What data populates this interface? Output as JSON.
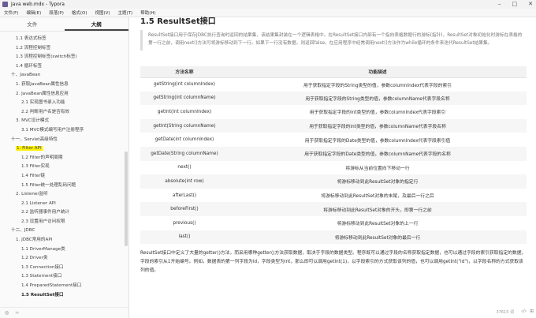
{
  "window": {
    "title": "Java web.mdx - Typora",
    "controls": [
      "–",
      "□",
      "✕"
    ]
  },
  "menu": [
    "文件(F)",
    "编辑(E)",
    "段落(P)",
    "格式(O)",
    "视图(V)",
    "主题(T)",
    "帮助(H)"
  ],
  "sidebar": {
    "tabs": [
      "文件",
      "大纲"
    ],
    "active_tab": 1,
    "outline": [
      {
        "level": 2,
        "label": "1.1 表达式标签"
      },
      {
        "level": 2,
        "label": "1.2 流程控制标签"
      },
      {
        "level": 2,
        "label": "1.3 流程控制标签(switch标签)"
      },
      {
        "level": 2,
        "label": "1.4 循环标签"
      },
      {
        "level": 1,
        "label": "十、JavaBean"
      },
      {
        "level": 2,
        "label": "1. 获取JavaBean属性信息"
      },
      {
        "level": 2,
        "label": "2. JavaBean属性信息应用"
      },
      {
        "level": 3,
        "label": "2.1 实现图书录入功能"
      },
      {
        "level": 3,
        "label": "2.2 判断用户名是否有效"
      },
      {
        "level": 2,
        "label": "3. MVC设计模式"
      },
      {
        "level": 3,
        "label": "3.1 MVC模式编写用户注册程序"
      },
      {
        "level": 1,
        "label": "十一、Servlet高级特性"
      },
      {
        "level": 2,
        "label": "1. Filter API",
        "highlight": true
      },
      {
        "level": 3,
        "label": "1.2 Filter的声明周期"
      },
      {
        "level": 3,
        "label": "1.3 Filter实现"
      },
      {
        "level": 3,
        "label": "1.4 Filter链"
      },
      {
        "level": 3,
        "label": "1.5 Filter统一处理乱码问题"
      },
      {
        "level": 2,
        "label": "2. Listener监听"
      },
      {
        "level": 3,
        "label": "2.1 Listener API"
      },
      {
        "level": 3,
        "label": "2.2 监听器事件用户统计"
      },
      {
        "level": 3,
        "label": "2.3 设置用户访问权限"
      },
      {
        "level": 1,
        "label": "十二、JDBC"
      },
      {
        "level": 2,
        "label": "1. JDBC常用的API"
      },
      {
        "level": 3,
        "label": "1.1 DriverManage类"
      },
      {
        "level": 3,
        "label": "1.2 Driver类"
      },
      {
        "level": 3,
        "label": "1.3 Connection接口"
      },
      {
        "level": 3,
        "label": "1.3 Statement接口"
      },
      {
        "level": 3,
        "label": "1.4 PreparedStatement接口"
      },
      {
        "level": 3,
        "label": "1.5 ResultSet接口",
        "current": true
      }
    ],
    "footer_icons": [
      "◎",
      "‹›"
    ]
  },
  "editor": {
    "heading": "1.5 ResultSet接口",
    "quote": "ResultSet接口用于保存JDBC执行查询时返回的结果集，该结果集封装在一个逻辑表格中。在ResultSet接口内部有一个指向表格数据行的游标(指针)，ResultSet对象初始化时游标在表格的第一行之前，调用next()方法可将游标移动到下一行。如果下一行没有数据，则返回false。在应用程序中经常调用next()方法作为while循环的条件来迭代ResultSet结果集。",
    "table": {
      "headers": [
        "方法名称",
        "功能描述"
      ],
      "rows": [
        [
          "getString(int columnIndex)",
          "用于获取指定字段的String类型的值，参数columnIndex代表字段的索引"
        ],
        [
          "getString(int columnName)",
          "用于获取指定字段的String类型的值，参数columnName代表字段名称"
        ],
        [
          "getInt(int columnIndex)",
          "用于获取指定字段的int类型的值，参数columnIndex代表字段索引"
        ],
        [
          "getInt(String columnName)",
          "用于获取指定字段的int类型的值，参数columnName代表字段名称"
        ],
        [
          "getDate(int columnIndex)",
          "用于获取指定字段的Date类型的值，参数columnIndex代表字段索引值"
        ],
        [
          "getDate(String columnName)",
          "用于获取指定字段的Date类型的值，参数columnName代表字段的名称"
        ],
        [
          "next()",
          "将游标从当前位置向下移动一行"
        ],
        [
          "absolute(int row)",
          "将游标移动到此ResultSet对象的指定行"
        ],
        [
          "afterLast()",
          "将游标移动到此ResultSet对象的末尾，及最后一行之后"
        ],
        [
          "beforeFirst()",
          "将游标移动到此ResultSet对象的开头，即第一行之前"
        ],
        [
          "previous()",
          "将游标移动到此ResultSet对象的上一行"
        ],
        [
          "last()",
          "将游标移动到此ResultSet对象的最后一行"
        ]
      ]
    },
    "paragraph": "ResultSet接口中定义了大量的getter()方法，而采用哪种getter()方法获取数据，取决于字段的数据类型。程序既可以通过字段的名称获取指定数据，也可以通过字段的索引获取指定的数据，字段的索引从1开始编号。例如，数据表的第一列字段为id，字段类型为int，那么即可以调用getInt(1)，以字段索引的方式获取该列的值，也可以调用getInt(\"id\")，以字段名称的方式获取该列的值。"
  },
  "status": {
    "word_count": "37615 词",
    "icon_left": "‹/›",
    "icon_right": "⊞"
  }
}
